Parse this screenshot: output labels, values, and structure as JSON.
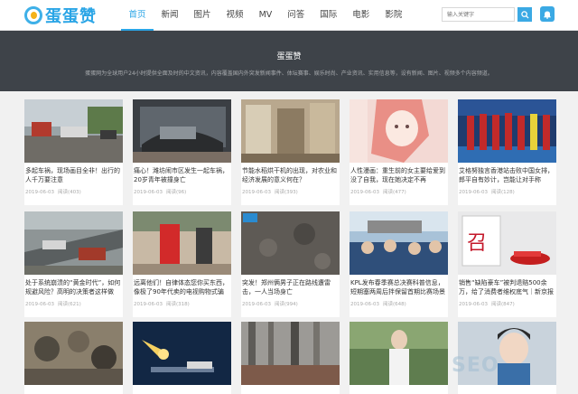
{
  "brand": {
    "name": "蛋蛋赞"
  },
  "nav": {
    "items": [
      "首页",
      "新闻",
      "图片",
      "视频",
      "MV",
      "问答",
      "国际",
      "电影",
      "影院"
    ],
    "active": 0
  },
  "search": {
    "placeholder": "输入关键字"
  },
  "banner": {
    "title": "蛋蛋赞",
    "desc": "蛋蛋网为全球用户24小时提供全面及时的中文资讯，内容覆盖国内外突发新闻事件、体坛赛事、娱乐时尚、产业资讯、实用信息等，设有新闻、图片、视频多个内容频道。"
  },
  "cards": [
    {
      "title": "多起车祸，现场画目全非！出行的人千万要注意",
      "date": "2019-06-03",
      "views": "阅读(403)"
    },
    {
      "title": "痛心！潍坊闹市区发生一起车祸，20岁青年被撞身亡",
      "date": "2019-06-03",
      "views": "阅读(96)"
    },
    {
      "title": "节能水稻烘干机的出现，对农业和经济发展的意义何在？",
      "date": "2019-06-03",
      "views": "阅读(393)"
    },
    {
      "title": "人性漫画：重生前的女主要给爱到没了自我，现在她决定不再",
      "date": "2019-06-03",
      "views": "阅读(477)"
    },
    {
      "title": "艾格努独言香港站击败中国女排，郎平自有妙计，岂能让对手称",
      "date": "2019-06-03",
      "views": "阅读(128)"
    },
    {
      "title": "处于系统崩溃的“黄金时代”，如何规避风险？高明的决策者这样做",
      "date": "2019-06-03",
      "views": "阅读(621)"
    },
    {
      "title": "远离他们！自律体态您你买东西，像极了90年代卖的电视购物式骗局",
      "date": "2019-06-03",
      "views": "阅读(318)"
    },
    {
      "title": "突发！郑州俩男子正在路线遭雷击，一人当场身亡",
      "date": "2019-06-03",
      "views": "阅读(994)"
    },
    {
      "title": "KPL发布春季赛总决赛科普信息，短期塞两周后拌保留首期比赛场景",
      "date": "2019-06-03",
      "views": "阅读(648)"
    },
    {
      "title": "销售“缺陷豪车”被判退赔500余万，给了消费者维权底气｜新京报",
      "date": "2019-06-03",
      "views": "阅读(847)"
    }
  ],
  "watermark": "SEO"
}
